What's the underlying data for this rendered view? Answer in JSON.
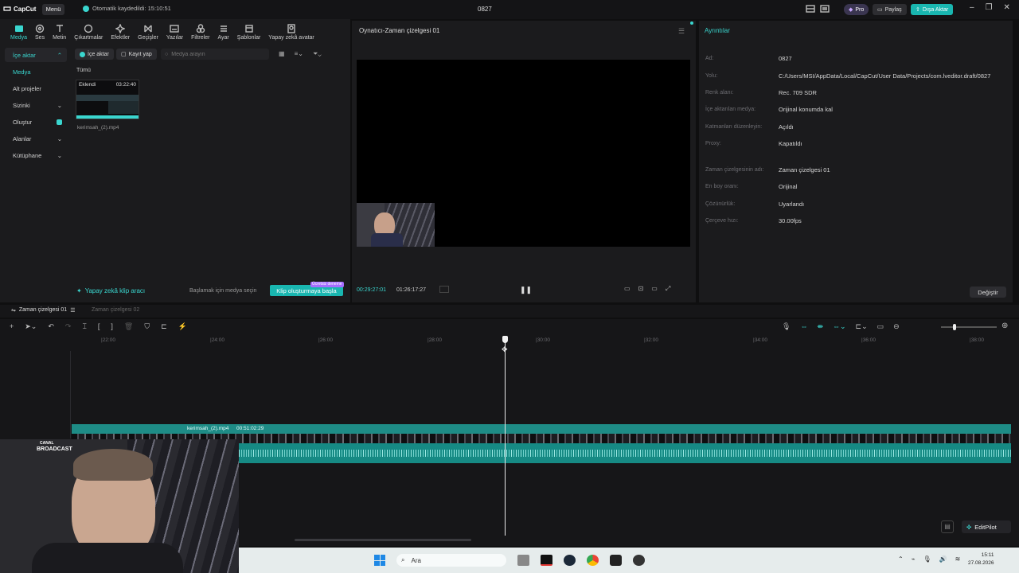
{
  "app": {
    "logo": "CapCut",
    "menu_label": "Menü",
    "autosave": "Otomatik kaydedildi: 15:10:51",
    "project_title": "0827",
    "pro_label": "Pro",
    "share_label": "Paylaş",
    "export_label": "Dışa Aktar"
  },
  "toolbar": {
    "items": [
      "Medya",
      "Ses",
      "Metin",
      "Çıkartmalar",
      "Efektler",
      "Geçişler",
      "Yazılar",
      "Filtreler",
      "Ayar",
      "Şablonlar",
      "Yapay zekâ avatar"
    ]
  },
  "sidebar": {
    "items": [
      "İçe aktar",
      "Medya",
      "Alt projeler",
      "Sizinki",
      "Oluştur",
      "Alanlar",
      "Kütüphane"
    ]
  },
  "media": {
    "import_btn": "İçe aktar",
    "record_btn": "Kayıt yap",
    "search_placeholder": "Medya arayın",
    "all_label": "Tümü",
    "clip_badge": "Eklendi",
    "clip_duration": "03:22:40",
    "clip_name": "kerimsah_(2).mp4",
    "ai_clip_tool": "Yapay zekâ klip aracı",
    "start_hint": "Başlamak için medya seçin",
    "create_clip_btn": "Klip oluşturmaya başla",
    "new_badge": "Ücretsiz deneme"
  },
  "player": {
    "title": "Oynatıcı-Zaman çizelgesi 01",
    "current_time": "00:29:27:01",
    "total_time": "01:26:17:27"
  },
  "details": {
    "tab": "Ayrıntılar",
    "rows": [
      {
        "label": "Ad:",
        "value": "0827"
      },
      {
        "label": "Yolu:",
        "value": "C:/Users/MSI/AppData/Local/CapCut/User Data/Projects/com.lveditor.draft/0827"
      },
      {
        "label": "Renk alanı:",
        "value": "Rec. 709 SDR"
      },
      {
        "label": "İçe aktarılan medya:",
        "value": "Orijinal konumda kal"
      },
      {
        "label": "Katmanları düzenleyin:",
        "value": "Açıldı"
      },
      {
        "label": "Proxy:",
        "value": "Kapatıldı"
      },
      {
        "label": "Zaman çizelgesinin adı:",
        "value": "Zaman çizelgesi 01"
      },
      {
        "label": "En boy oranı:",
        "value": "Orijinal"
      },
      {
        "label": "Çözünürlük:",
        "value": "Uyarlandı"
      },
      {
        "label": "Çerçeve hızı:",
        "value": "30.00fps"
      }
    ],
    "modify_btn": "Değiştir"
  },
  "timeline": {
    "tab1": "Zaman çizelgesi 01",
    "tab2": "Zaman çizelgesi 02",
    "ticks": [
      "|22:00",
      "|24:00",
      "|26:00",
      "|28:00",
      "|30:00",
      "|32:00",
      "|34:00",
      "|36:00",
      "|38:00"
    ],
    "clip_label": "kerimsah_(2).mp4",
    "clip_duration": "00:51:02:29",
    "editpilot": "EditPilot"
  },
  "webcam": {
    "brand_top": "CANAL",
    "brand": "BROADCAST"
  },
  "taskbar": {
    "search": "Ara",
    "time": "15:11",
    "date": "27.08.2026"
  },
  "colors": {
    "accent": "#3ad6cf",
    "track": "#1e8c86",
    "export": "#19b6b0"
  }
}
